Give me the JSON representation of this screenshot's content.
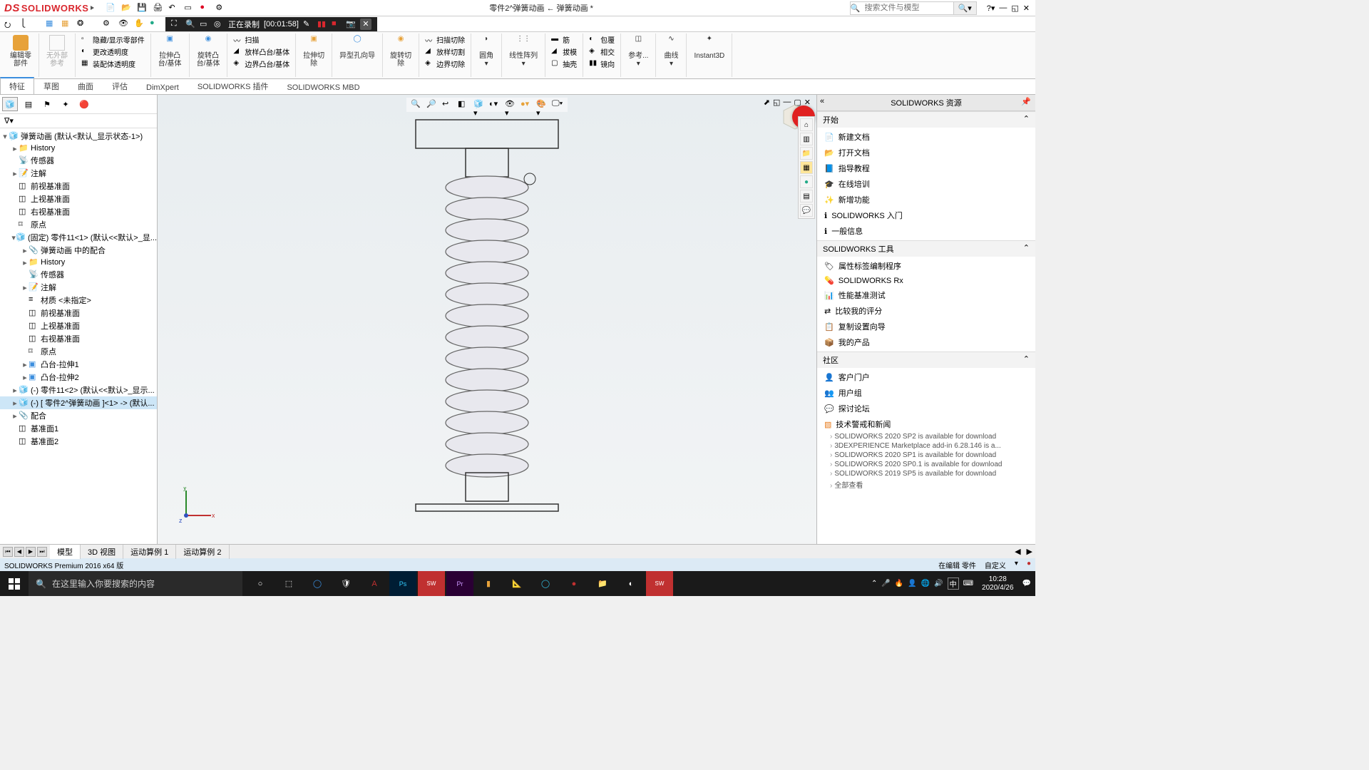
{
  "app_name": "SOLIDWORKS",
  "window_title": "零件2^弹簧动画 ← 弹簧动画 *",
  "search_placeholder": "搜索文件与模型",
  "recording": {
    "status_prefix": "正在录制",
    "time": "[00:01:58]"
  },
  "ribbon": {
    "edit_part": {
      "l1": "编辑零",
      "l2": "部件"
    },
    "ext_ref": {
      "l1": "无外部",
      "l2": "参考"
    },
    "vis": {
      "hide": "隐藏/显示零部件",
      "opacity": "更改透明度",
      "assy_opacity": "装配体透明度"
    },
    "extrude": {
      "l1": "拉伸凸",
      "l2": "台/基体"
    },
    "revolve": {
      "l1": "旋转凸",
      "l2": "台/基体"
    },
    "sweep_loft": {
      "sweep": "扫描",
      "loft": "放样凸台/基体",
      "boundary": "边界凸台/基体"
    },
    "cut_extrude": {
      "l1": "拉伸切",
      "l2": "除"
    },
    "hole_wizard": "异型孔向导",
    "cut_revolve": {
      "l1": "旋转切",
      "l2": "除"
    },
    "cut_sweep_loft": {
      "sweep": "扫描切除",
      "loft": "放样切割",
      "boundary": "边界切除"
    },
    "fillet": "圆角",
    "linear_pattern": "线性阵列",
    "rib_draft": {
      "rib": "筋",
      "draft": "拔模",
      "shell": "抽壳"
    },
    "wrap_intersect": {
      "wrap": "包覆",
      "intersect": "相交",
      "mirror": "镜向"
    },
    "ref_geom": {
      "l1": "参考...",
      "l2": ""
    },
    "curves": "曲线",
    "instant3d": "Instant3D"
  },
  "tabs": [
    "特征",
    "草图",
    "曲面",
    "评估",
    "DimXpert",
    "SOLIDWORKS 插件",
    "SOLIDWORKS MBD"
  ],
  "tree": {
    "root": "弹簧动画  (默认<默认_显示状态-1>)",
    "history": "History",
    "sensors": "传感器",
    "annotations": "注解",
    "front_plane": "前视基准面",
    "top_plane": "上视基准面",
    "right_plane": "右视基准面",
    "origin": "原点",
    "part11_fixed": "(固定) 零件11<1> (默认<<默认>_显...",
    "mates_in": "弹簧动画 中的配合",
    "history2": "History",
    "sensors2": "传感器",
    "annotations2": "注解",
    "material": "材质 <未指定>",
    "front2": "前视基准面",
    "top2": "上视基准面",
    "right2": "右视基准面",
    "origin2": "原点",
    "boss1": "凸台-拉伸1",
    "boss2": "凸台-拉伸2",
    "part11_2": "(-) 零件11<2> (默认<<默认>_显示...",
    "part2_selected": "(-) [ 零件2^弹簧动画 ]<1> -> (默认...",
    "mates": "配合",
    "datum1": "基准面1",
    "datum2": "基准面2"
  },
  "bottom_tabs": [
    "模型",
    "3D 视图",
    "运动算例 1",
    "运动算例 2"
  ],
  "status": {
    "version": "SOLIDWORKS Premium 2016 x64 版",
    "editing": "在编辑 零件",
    "custom": "自定义"
  },
  "rightpanel": {
    "title": "SOLIDWORKS 资源",
    "start": {
      "h": "开始",
      "items": [
        "新建文档",
        "打开文档",
        "指导教程",
        "在线培训",
        "新增功能",
        "SOLIDWORKS 入门",
        "一般信息"
      ]
    },
    "tools": {
      "h": "SOLIDWORKS 工具",
      "items": [
        "属性标签编制程序",
        "SOLIDWORKS Rx",
        "性能基准测试",
        "比较我的评分",
        "复制设置向导",
        "我的产品"
      ]
    },
    "community": {
      "h": "社区",
      "items": [
        "客户门户",
        "用户组",
        "探讨论坛",
        "技术警戒和新闻"
      ]
    },
    "news": [
      "SOLIDWORKS 2020 SP2 is available for download",
      "3DEXPERIENCE Marketplace add-in 6.28.146 is a...",
      "SOLIDWORKS 2020 SP1 is available for download",
      "SOLIDWORKS 2020 SP0.1 is available for download",
      "SOLIDWORKS 2019 SP5 is available for download"
    ],
    "view_all": "全部查看"
  },
  "taskbar": {
    "search_placeholder": "在这里输入你要搜索的内容",
    "ime": "中",
    "time": "10:28",
    "date": "2020/4/26"
  }
}
